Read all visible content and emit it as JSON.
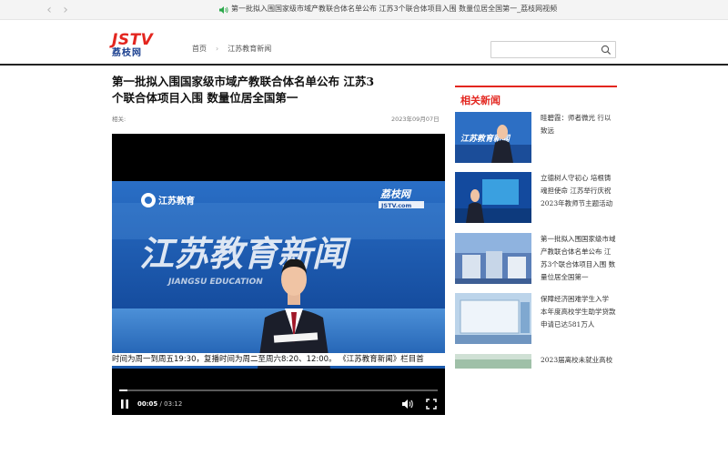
{
  "browser": {
    "tab_title": "第一批拟入围国家级市域产教联合体名单公布 江苏3个联合体项目入围 数量位居全国第一_荔枝网视频",
    "back_glyph": "‹",
    "forward_glyph": "›",
    "icons": {
      "back": "chevron-left-icon",
      "forward": "chevron-right-icon",
      "audio": "speaker-icon"
    }
  },
  "header": {
    "logo_top": "JSTV",
    "logo_bottom": "荔枝网",
    "breadcrumb": [
      "首页",
      "江苏教育新闻"
    ],
    "breadcrumb_sep": "›",
    "search": {
      "placeholder": "",
      "icon": "search-icon"
    }
  },
  "article": {
    "title": "第一批拟入围国家级市域产教联合体名单公布 江苏3个联合体项目入围 数量位居全国第一",
    "author_label": "相关:",
    "date": "2023年09月07日"
  },
  "video": {
    "channel_logo": "江苏教育",
    "watermark_top": "荔枝网",
    "watermark_bottom": "JSTV.com",
    "backdrop_title": "江苏教育新闻",
    "backdrop_sub": "JIANGSU EDUCATION",
    "ticker": "时间为周一到周五19:30，复播时间为周二至周六8:20、12:00。 《江苏教育新闻》栏目首",
    "current_time": "00:05",
    "time_sep": " / ",
    "duration": "03:12",
    "progress_fraction": 0.026,
    "icons": {
      "play": "pause-icon",
      "volume": "volume-icon",
      "fullscreen": "fullscreen-icon"
    }
  },
  "sidebar": {
    "title": "相关新闻",
    "items": [
      {
        "text": "眭碧霞：师者微光 行以致远",
        "thumb_label": "江苏教育新闻"
      },
      {
        "text": "立德树人守初心 培根铸魂担使命 江苏举行庆祝2023年教师节主题活动",
        "thumb_label": ""
      },
      {
        "text": "第一批拟入围国家级市域产教联合体名单公布 江苏3个联合体项目入围 数量位居全国第一",
        "thumb_label": ""
      },
      {
        "text": "保障经济困难学生入学 本年度高校学生助学贷款申请已达581万人",
        "thumb_label": ""
      },
      {
        "text": "2023届离校未就业高校",
        "thumb_label": ""
      }
    ]
  },
  "colors": {
    "brand_red": "#e3261f",
    "brand_blue": "#1a3f8f",
    "header_rule": "#222222"
  }
}
